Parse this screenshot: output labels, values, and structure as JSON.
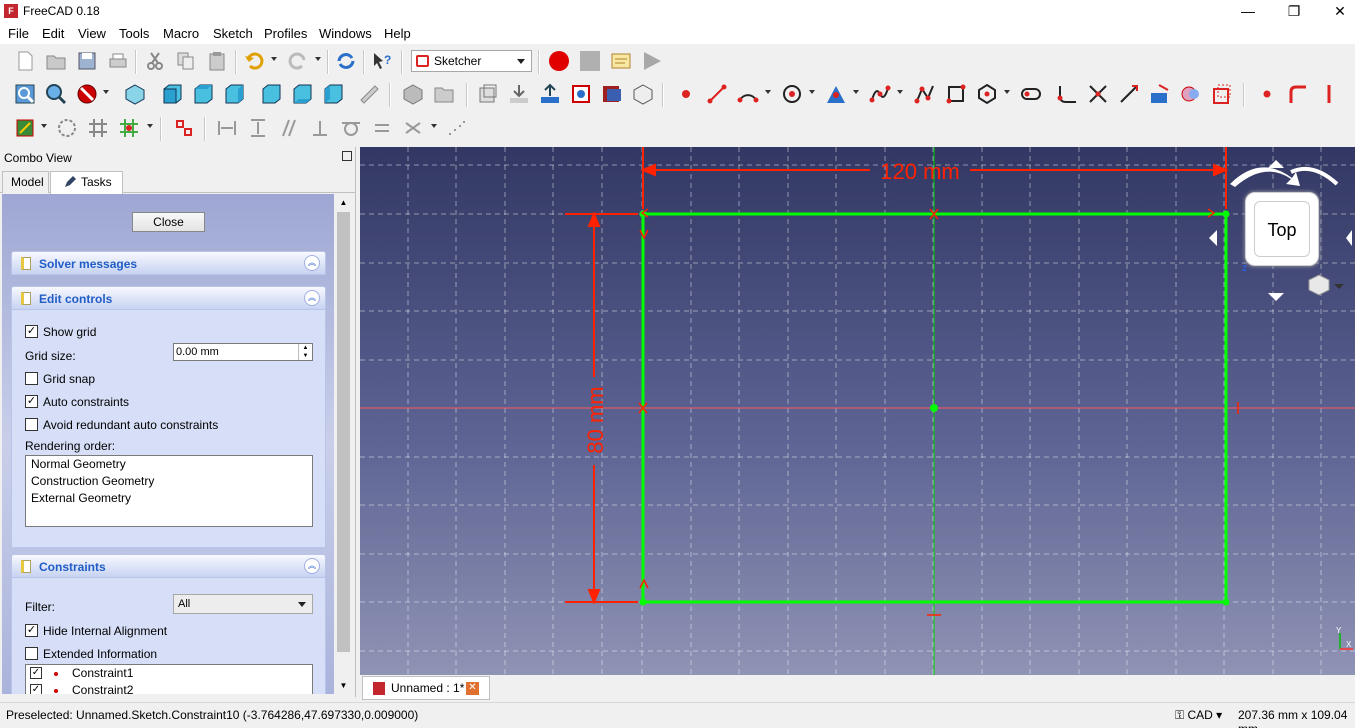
{
  "window": {
    "title": "FreeCAD 0.18",
    "app_icon": "freecad-logo-icon",
    "minimize": "—",
    "maximize": "❐",
    "close": "✕"
  },
  "menu": [
    "File",
    "Edit",
    "View",
    "Tools",
    "Macro",
    "Sketch",
    "Profiles",
    "Windows",
    "Help"
  ],
  "toolbar": {
    "workbench": "Sketcher"
  },
  "combo_view": {
    "header": "Combo View",
    "tabs": [
      "Model",
      "Tasks"
    ],
    "active_tab": "Tasks",
    "close_button": "Close",
    "panels": {
      "solver": {
        "title": "Solver messages"
      },
      "edit_controls": {
        "title": "Edit controls",
        "show_grid": {
          "label": "Show grid",
          "checked": true,
          "mark": "✓"
        },
        "grid_size": {
          "label": "Grid size:",
          "value": "0.00 mm"
        },
        "grid_snap": {
          "label": "Grid snap",
          "checked": false,
          "mark": ""
        },
        "auto_constraints": {
          "label": "Auto constraints",
          "checked": true,
          "mark": "✓"
        },
        "avoid_redundant": {
          "label": "Avoid redundant auto constraints",
          "checked": false,
          "mark": ""
        },
        "rendering_order_label": "Rendering order:",
        "rendering_order": [
          "Normal Geometry",
          "Construction Geometry",
          "External Geometry"
        ]
      },
      "constraints": {
        "title": "Constraints",
        "filter_label": "Filter:",
        "filter_value": "All",
        "hide_internal": {
          "label": "Hide Internal Alignment",
          "checked": true,
          "mark": "✓"
        },
        "extended_info": {
          "label": "Extended Information",
          "checked": false,
          "mark": ""
        },
        "items": [
          {
            "name": "Constraint1",
            "mark": "✓"
          },
          {
            "name": "Constraint2",
            "mark": "✓"
          }
        ]
      }
    }
  },
  "viewport": {
    "dimension_horizontal": "120 mm",
    "dimension_vertical": "80 mm",
    "navcube_face": "Top",
    "axis_z": "z",
    "axis_y": "Y",
    "axis_x": "X",
    "colors": {
      "geometry": "#00ff00",
      "dimension": "#ff2200",
      "axis_h": "#ff5a5a",
      "axis_v": "#00d000",
      "grid": "#ffffff"
    }
  },
  "document_tab": {
    "label": "Unnamed : 1*",
    "close": "✕"
  },
  "status": {
    "preselected": "Preselected: Unnamed.Sketch.Constraint10 (-3.764286,47.697330,0.009000)",
    "nav_style": "CAD",
    "dimensions": "207.36 mm x 109.04 mm"
  }
}
